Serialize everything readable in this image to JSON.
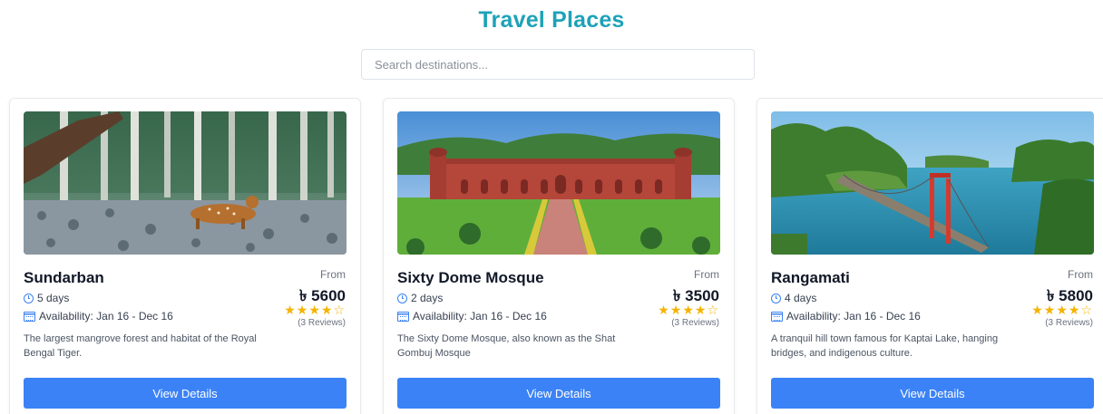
{
  "header": {
    "title": "Travel Places"
  },
  "search": {
    "placeholder": "Search destinations..."
  },
  "cards": [
    {
      "title": "Sundarban",
      "from_label": "From",
      "price": "৳ 5600",
      "rating": 4,
      "stars": "★★★★",
      "empty_stars": "☆",
      "reviews": "(3 Reviews)",
      "duration": "5 days",
      "availability": "Availability: Jan 16 - Dec 16",
      "description": "The largest mangrove forest and habitat of the Royal Bengal Tiger.",
      "button_label": "View Details"
    },
    {
      "title": "Sixty Dome Mosque",
      "from_label": "From",
      "price": "৳ 3500",
      "rating": 4,
      "stars": "★★★★",
      "empty_stars": "☆",
      "reviews": "(3 Reviews)",
      "duration": "2 days",
      "availability": "Availability: Jan 16 - Dec 16",
      "description": "The Sixty Dome Mosque, also known as the Shat Gombuj Mosque",
      "button_label": "View Details"
    },
    {
      "title": "Rangamati",
      "from_label": "From",
      "price": "৳ 5800",
      "rating": 4,
      "stars": "★★★★",
      "empty_stars": "☆",
      "reviews": "(3 Reviews)",
      "duration": "4 days",
      "availability": "Availability: Jan 16 - Dec 16",
      "description": "A tranquil hill town famous for Kaptai Lake, hanging bridges, and indigenous culture.",
      "button_label": "View Details"
    }
  ],
  "colors": {
    "title": "#1ea2b8",
    "button": "#3b82f6",
    "star": "#f5b301",
    "icon": "#3b82f6"
  }
}
